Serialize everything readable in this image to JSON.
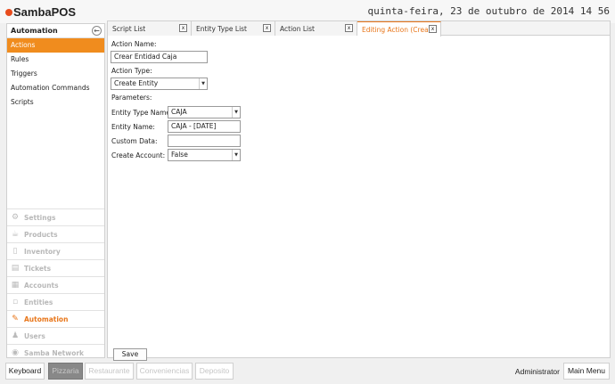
{
  "app": {
    "logo": "SambaPOS",
    "datetime": "quinta-feira, 23 de outubro de 2014 14 56"
  },
  "sidebar": {
    "title": "Automation",
    "items": [
      {
        "label": "Actions",
        "active": true
      },
      {
        "label": "Rules"
      },
      {
        "label": "Triggers"
      },
      {
        "label": "Automation Commands"
      },
      {
        "label": "Scripts"
      }
    ],
    "nav": [
      {
        "label": "Settings",
        "icon": "gear-icon"
      },
      {
        "label": "Products",
        "icon": "coffee-cup-icon"
      },
      {
        "label": "Inventory",
        "icon": "inventory-icon"
      },
      {
        "label": "Tickets",
        "icon": "tickets-icon"
      },
      {
        "label": "Accounts",
        "icon": "calculator-icon"
      },
      {
        "label": "Entities",
        "icon": "entities-icon"
      },
      {
        "label": "Automation",
        "icon": "pen-icon",
        "active": true
      },
      {
        "label": "Users",
        "icon": "users-icon"
      },
      {
        "label": "Samba Network",
        "icon": "globe-icon"
      }
    ]
  },
  "tabs": [
    {
      "label": "Script List",
      "close": "x"
    },
    {
      "label": "Entity Type List",
      "close": "x"
    },
    {
      "label": "Action List",
      "close": "x"
    },
    {
      "label": "Editing Action (Crear",
      "close": "x",
      "active": true
    }
  ],
  "form": {
    "action_name_label": "Action Name:",
    "action_name_value": "Crear Entidad Caja",
    "action_type_label": "Action Type:",
    "action_type_value": "Create Entity",
    "parameters_label": "Parameters:",
    "params": [
      {
        "label": "Entity Type Name:",
        "value": "CAJA",
        "select": true
      },
      {
        "label": "Entity Name:",
        "value": "CAJA - [DATE]"
      },
      {
        "label": "Custom Data:",
        "value": ""
      },
      {
        "label": "Create Account:",
        "value": "False",
        "select": true
      }
    ],
    "save_label": "Save"
  },
  "bottom": {
    "keyboard": "Keyboard",
    "departments": [
      "Pizzaria",
      "Restaurante",
      "Conveniencias",
      "Deposito"
    ],
    "user": "Administrator",
    "main_menu": "Main Menu"
  },
  "colors": {
    "accent": "#f08c1e",
    "selected_department": "#888888"
  }
}
